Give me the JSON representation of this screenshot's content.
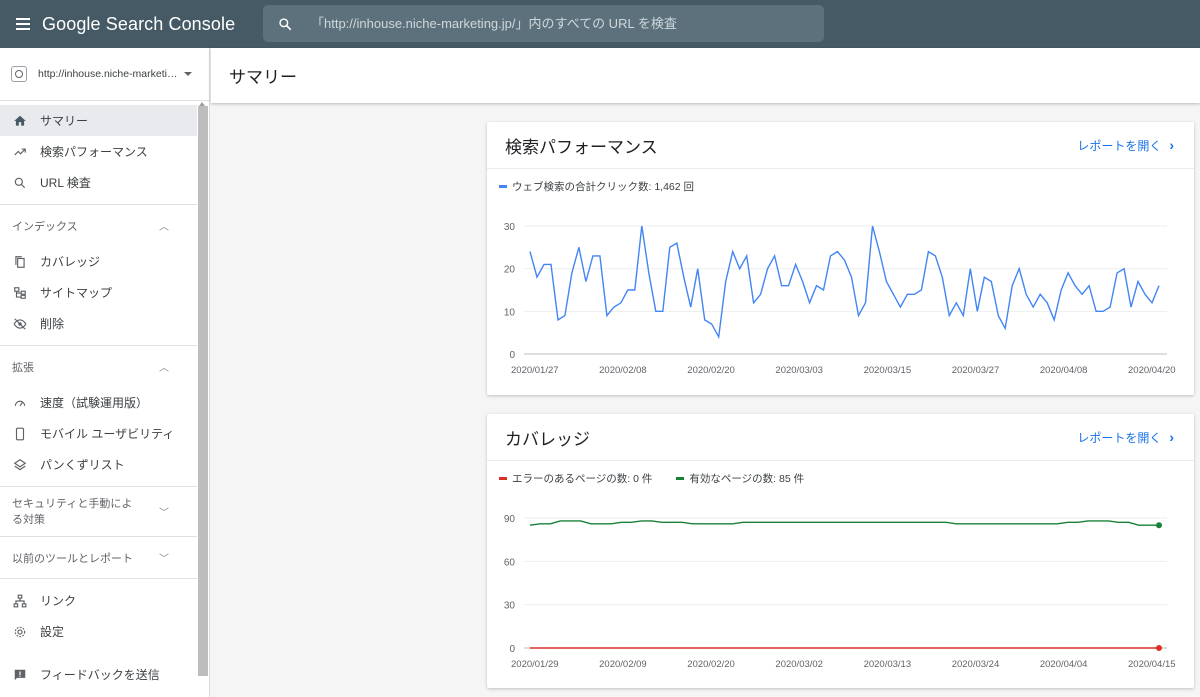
{
  "app": {
    "title": "Google Search Console"
  },
  "search": {
    "placeholder": "「http://inhouse.niche-marketing.jp/」内のすべての URL を検査"
  },
  "property": {
    "label": "http://inhouse.niche-marketin..."
  },
  "sidebar": {
    "top_items": [
      {
        "label": "サマリー",
        "icon": "home-icon",
        "active": true
      },
      {
        "label": "検索パフォーマンス",
        "icon": "trending-up-icon"
      },
      {
        "label": "URL 検査",
        "icon": "search-icon"
      }
    ],
    "index_section": {
      "label": "インデックス",
      "items": [
        {
          "label": "カバレッジ",
          "icon": "copy-icon"
        },
        {
          "label": "サイトマップ",
          "icon": "sitemap-icon"
        },
        {
          "label": "削除",
          "icon": "visibility-off-icon"
        }
      ]
    },
    "enhance_section": {
      "label": "拡張",
      "items": [
        {
          "label": "速度（試験運用版）",
          "icon": "speed-icon"
        },
        {
          "label": "モバイル ユーザビリティ",
          "icon": "smartphone-icon"
        },
        {
          "label": "パンくずリスト",
          "icon": "layers-icon"
        }
      ]
    },
    "security_section": {
      "label": "セキュリティと手動による対策"
    },
    "legacy_section": {
      "label": "以前のツールとレポート"
    },
    "bottom_items": [
      {
        "label": "リンク",
        "icon": "links-icon"
      },
      {
        "label": "設定",
        "icon": "settings-icon"
      },
      {
        "label": "フィードバックを送信",
        "icon": "feedback-icon"
      }
    ]
  },
  "page": {
    "title": "サマリー"
  },
  "performance_card": {
    "title": "検索パフォーマンス",
    "link": "レポートを開く",
    "legend": "ウェブ検索の合計クリック数: 1,462 回",
    "color": "#4285f4"
  },
  "coverage_card": {
    "title": "カバレッジ",
    "link": "レポートを開く",
    "legend_error": "エラーのあるページの数: 0 件",
    "legend_valid": "有効なページの数: 85 件",
    "error_color": "#d93025",
    "valid_color": "#188038"
  },
  "chart_data": [
    {
      "type": "line",
      "title": "",
      "xlabel": "",
      "ylabel": "",
      "ylim": [
        0,
        30
      ],
      "yticks": [
        0,
        10,
        20,
        30
      ],
      "xtick_labels": [
        "2020/01/27",
        "2020/02/08",
        "2020/02/20",
        "2020/03/03",
        "2020/03/15",
        "2020/03/27",
        "2020/04/08",
        "2020/04/20"
      ],
      "x_start": "2020/01/27",
      "grid": true,
      "series": [
        {
          "name": "ウェブ検索の合計クリック数",
          "color": "#4285f4",
          "values": [
            24,
            18,
            21,
            21,
            8,
            9,
            19,
            25,
            17,
            23,
            23,
            9,
            11,
            12,
            15,
            15,
            30,
            19,
            10,
            10,
            25,
            26,
            18,
            11,
            20,
            8,
            7,
            4,
            17,
            24,
            20,
            23,
            12,
            14,
            20,
            23,
            16,
            16,
            21,
            17,
            12,
            16,
            15,
            23,
            24,
            22,
            18,
            9,
            12,
            30,
            24,
            17,
            14,
            11,
            14,
            14,
            15,
            24,
            23,
            18,
            9,
            12,
            9,
            20,
            10,
            18,
            17,
            9,
            6,
            16,
            20,
            14,
            11,
            14,
            12,
            8,
            15,
            19,
            16,
            14,
            16,
            10,
            10,
            11,
            19,
            20,
            11,
            17,
            14,
            12,
            16
          ]
        }
      ]
    },
    {
      "type": "line",
      "title": "",
      "xlabel": "",
      "ylabel": "",
      "ylim": [
        0,
        90
      ],
      "yticks": [
        0,
        30,
        60,
        90
      ],
      "xtick_labels": [
        "2020/01/29",
        "2020/02/09",
        "2020/02/20",
        "2020/03/02",
        "2020/03/13",
        "2020/03/24",
        "2020/04/04",
        "2020/04/15"
      ],
      "x_start": "2020/01/29",
      "grid": true,
      "series": [
        {
          "name": "有効なページの数",
          "color": "#188038",
          "values": [
            85,
            86,
            86,
            88,
            88,
            88,
            86,
            86,
            86,
            87,
            87,
            88,
            88,
            87,
            87,
            87,
            86,
            86,
            86,
            86,
            86,
            87,
            87,
            87,
            87,
            87,
            87,
            87,
            87,
            87,
            87,
            87,
            87,
            87,
            87,
            87,
            87,
            87,
            87,
            87,
            87,
            87,
            86,
            86,
            86,
            86,
            86,
            86,
            86,
            86,
            86,
            86,
            86,
            87,
            87,
            88,
            88,
            88,
            87,
            87,
            85,
            85,
            85
          ]
        },
        {
          "name": "エラーのあるページの数",
          "color": "#d93025",
          "values": [
            0,
            0,
            0,
            0,
            0,
            0,
            0,
            0,
            0,
            0,
            0,
            0,
            0,
            0,
            0,
            0,
            0,
            0,
            0,
            0,
            0,
            0,
            0,
            0,
            0,
            0,
            0,
            0,
            0,
            0,
            0,
            0,
            0,
            0,
            0,
            0,
            0,
            0,
            0,
            0,
            0,
            0,
            0,
            0,
            0,
            0,
            0,
            0,
            0,
            0,
            0,
            0,
            0,
            0,
            0,
            0,
            0,
            0,
            0,
            0,
            0,
            0,
            0
          ]
        }
      ]
    }
  ]
}
